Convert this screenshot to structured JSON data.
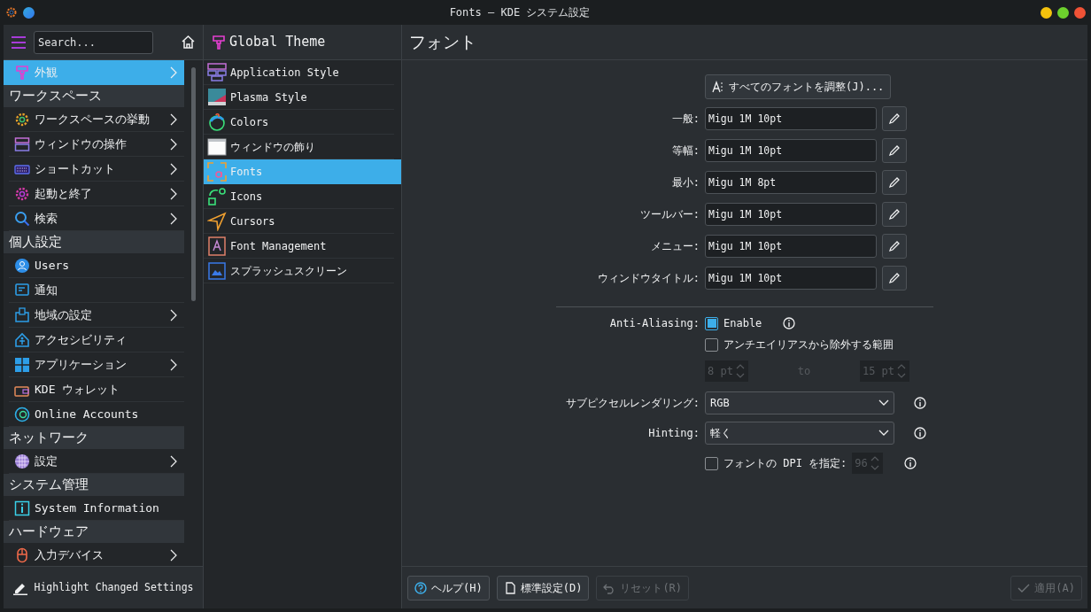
{
  "window": {
    "title": "Fonts — KDE システム設定"
  },
  "sidebar": {
    "search": {
      "placeholder": "Search..."
    },
    "items": [
      {
        "kind": "item",
        "label": "外観",
        "selected": true,
        "has_children": true
      },
      {
        "kind": "header",
        "label": "ワークスペース"
      },
      {
        "kind": "item",
        "label": "ワークスペースの挙動",
        "selected": false,
        "has_children": true
      },
      {
        "kind": "item",
        "label": "ウィンドウの操作",
        "selected": false,
        "has_children": true
      },
      {
        "kind": "item",
        "label": "ショートカット",
        "selected": false,
        "has_children": true
      },
      {
        "kind": "item",
        "label": "起動と終了",
        "selected": false,
        "has_children": true
      },
      {
        "kind": "item",
        "label": "検索",
        "selected": false,
        "has_children": true
      },
      {
        "kind": "header",
        "label": "個人設定"
      },
      {
        "kind": "item",
        "label": "Users",
        "selected": false,
        "has_children": false
      },
      {
        "kind": "item",
        "label": "通知",
        "selected": false,
        "has_children": false
      },
      {
        "kind": "item",
        "label": "地域の設定",
        "selected": false,
        "has_children": true
      },
      {
        "kind": "item",
        "label": "アクセシビリティ",
        "selected": false,
        "has_children": false
      },
      {
        "kind": "item",
        "label": "アプリケーション",
        "selected": false,
        "has_children": true
      },
      {
        "kind": "item",
        "label": "KDE ウォレット",
        "selected": false,
        "has_children": false
      },
      {
        "kind": "item",
        "label": "Online Accounts",
        "selected": false,
        "has_children": false
      },
      {
        "kind": "header",
        "label": "ネットワーク"
      },
      {
        "kind": "item",
        "label": "設定",
        "selected": false,
        "has_children": true
      },
      {
        "kind": "header",
        "label": "システム管理"
      },
      {
        "kind": "item",
        "label": "System Information",
        "selected": false,
        "has_children": false
      },
      {
        "kind": "header",
        "label": "ハードウェア"
      },
      {
        "kind": "item",
        "label": "入力デバイス",
        "selected": false,
        "has_children": true
      }
    ],
    "footer_button": "Highlight Changed Settings"
  },
  "subpanel": {
    "title": "Global Theme",
    "items": [
      {
        "label": "Application Style",
        "selected": false
      },
      {
        "label": "Plasma Style",
        "selected": false
      },
      {
        "label": "Colors",
        "selected": false
      },
      {
        "label": "ウィンドウの飾り",
        "selected": false
      },
      {
        "label": "Fonts",
        "selected": true
      },
      {
        "label": "Icons",
        "selected": false
      },
      {
        "label": "Cursors",
        "selected": false
      },
      {
        "label": "Font Management",
        "selected": false
      },
      {
        "label": "スプラッシュスクリーン",
        "selected": false
      }
    ]
  },
  "content": {
    "title": "フォント",
    "adjust_all_button": "すべてのフォントを調整(J)...",
    "font_rows": [
      {
        "label": "一般:",
        "value": "Migu 1M 10pt"
      },
      {
        "label": "等幅:",
        "value": "Migu 1M 10pt"
      },
      {
        "label": "最小:",
        "value": "Migu 1M 8pt"
      },
      {
        "label": "ツールバー:",
        "value": "Migu 1M 10pt"
      },
      {
        "label": "メニュー:",
        "value": "Migu 1M 10pt"
      },
      {
        "label": "ウィンドウタイトル:",
        "value": "Migu 1M 10pt"
      }
    ],
    "antialiasing": {
      "label": "Anti-Aliasing:",
      "enable": {
        "label": "Enable",
        "checked": true
      },
      "exclude": {
        "label": "アンチエイリアスから除外する範囲",
        "checked": false
      },
      "range_from": "8 pt",
      "range_separator": "to",
      "range_to": "15 pt"
    },
    "subpixel": {
      "label": "サブピクセルレンダリング:",
      "value": "RGB"
    },
    "hinting": {
      "label": "Hinting:",
      "value": "軽く"
    },
    "dpi": {
      "label": "フォントの DPI を指定:",
      "checked": false,
      "value": "96"
    }
  },
  "buttons": [
    {
      "kind": "help",
      "label": "ヘルプ(H)",
      "disabled": false
    },
    {
      "kind": "defaults",
      "label": "標準設定(D)",
      "disabled": false
    },
    {
      "kind": "reset",
      "label": "リセット(R)",
      "disabled": true
    },
    {
      "kind": "apply",
      "label": "適用(A)",
      "disabled": true
    }
  ]
}
